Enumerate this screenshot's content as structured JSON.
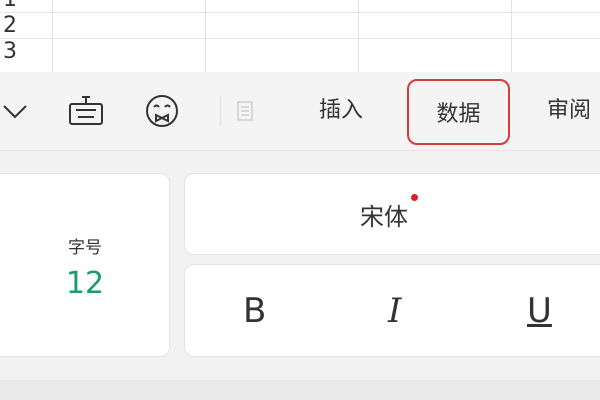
{
  "sheet": {
    "row_numbers": [
      "1",
      "2",
      "3"
    ]
  },
  "toolbar": {
    "icons": [
      "chevron-down-icon",
      "keyboard-icon",
      "emoji-icon",
      "document-icon"
    ],
    "tabs": [
      "插入",
      "数据",
      "审阅"
    ],
    "selected_tab": "数据",
    "accent_color": "#d83b3b"
  },
  "panel": {
    "font_size": {
      "label": "字号",
      "value": "12",
      "value_color": "#1f9a6e"
    },
    "font_name": {
      "value": "宋体",
      "indicator_color": "#e02020"
    },
    "styles": {
      "bold": "B",
      "italic": "I",
      "underline": "U"
    }
  }
}
